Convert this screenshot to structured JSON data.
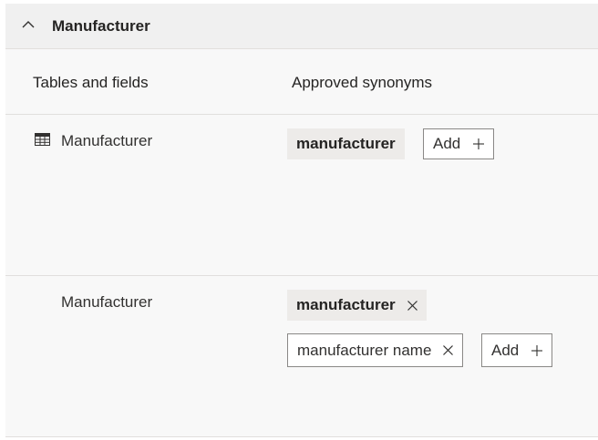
{
  "section": {
    "title": "Manufacturer",
    "collapse_icon": "chevron-up-icon"
  },
  "columns": {
    "tables_and_fields": "Tables and fields",
    "approved_synonyms": "Approved synonyms"
  },
  "rows": [
    {
      "label": "Manufacturer",
      "icon": "table-icon",
      "synonyms": [
        {
          "text": "manufacturer",
          "removable": false
        }
      ],
      "add_label": "Add"
    },
    {
      "label": "Manufacturer",
      "synonyms": [
        {
          "text": "manufacturer",
          "removable": true
        },
        {
          "text": "manufacturer name",
          "removable": true
        }
      ],
      "add_label": "Add"
    }
  ]
}
